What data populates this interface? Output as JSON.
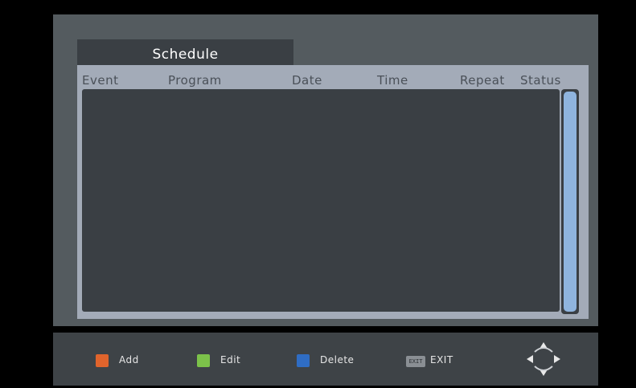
{
  "schedule": {
    "tab_title": "Schedule",
    "columns": {
      "event": "Event",
      "program": "Program",
      "date": "Date",
      "time": "Time",
      "repeat": "Repeat",
      "status": "Status"
    },
    "rows": []
  },
  "footer": {
    "add_label": "Add",
    "edit_label": "Edit",
    "delete_label": "Delete",
    "exit_badge": "EXIT",
    "exit_label": "EXIT"
  },
  "colors": {
    "add": "#e0642c",
    "edit": "#7cc24a",
    "delete": "#2f6dc4",
    "scroll_thumb": "#8fb4de"
  },
  "icons": {
    "navigation": "dpad-arrows-icon"
  }
}
